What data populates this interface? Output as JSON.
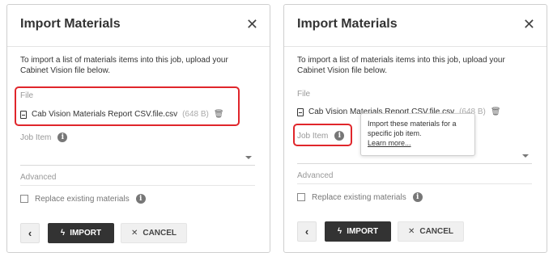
{
  "dialog": {
    "title": "Import Materials",
    "close_glyph": "✕",
    "description": "To import a list of materials items into this job, upload your Cabinet Vision file below.",
    "file_label": "File",
    "file_name": "Cab Vision Materials Report CSV.file.csv",
    "file_size": "(648 B)",
    "job_item_label": "Job Item",
    "advanced_label": "Advanced",
    "replace_label": "Replace existing materials",
    "replace_checked": false,
    "back_glyph": "‹",
    "import_icon_glyph": "ϟ",
    "import_label": "IMPORT",
    "cancel_icon_glyph": "✕",
    "cancel_label": "CANCEL",
    "info_glyph": "i",
    "trash_glyph": "🗑"
  },
  "tooltip": {
    "text": "Import these materials for a specific job item.",
    "link": "Learn more..."
  },
  "icons": [
    "close-icon",
    "document-icon",
    "trash-icon",
    "info-icon",
    "chevron-down-icon",
    "chevron-left-icon",
    "lightning-icon"
  ],
  "colors": {
    "highlight": "#e0262b",
    "primary_button": "#333333",
    "secondary_button": "#f0f0f0"
  }
}
